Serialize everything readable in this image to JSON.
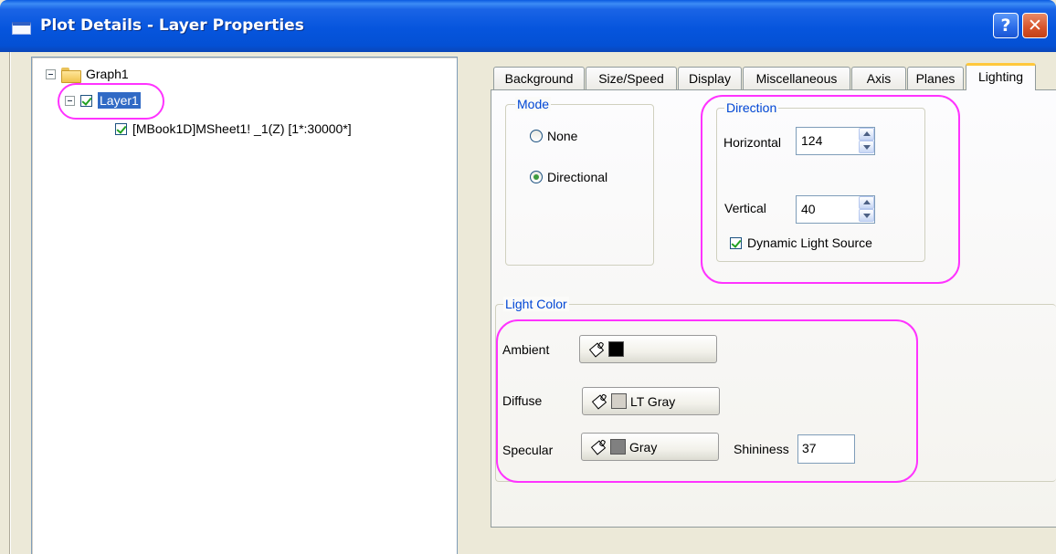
{
  "window": {
    "title": "Plot Details - Layer Properties",
    "help_glyph": "?",
    "close_glyph": "✕"
  },
  "tree": {
    "root": "Graph1",
    "layer": "Layer1",
    "dataset": "[MBook1D]MSheet1! _1(Z) [1*:30000*]"
  },
  "tabs": [
    "Background",
    "Size/Speed",
    "Display",
    "Miscellaneous",
    "Axis",
    "Planes",
    "Lighting"
  ],
  "active_tab": "Lighting",
  "mode": {
    "title": "Mode",
    "options": [
      "None",
      "Directional"
    ],
    "selected": "Directional"
  },
  "direction": {
    "title": "Direction",
    "horizontal_label": "Horizontal",
    "horizontal_value": "124",
    "vertical_label": "Vertical",
    "vertical_value": "40",
    "dynamic_label": "Dynamic Light Source",
    "dynamic_checked": true
  },
  "light_color": {
    "title": "Light Color",
    "ambient_label": "Ambient",
    "ambient_color": "#000000",
    "ambient_text": "",
    "diffuse_label": "Diffuse",
    "diffuse_color": "#d4d0c8",
    "diffuse_text": "LT Gray",
    "specular_label": "Specular",
    "specular_color": "#808080",
    "specular_text": "Gray",
    "shininess_label": "Shininess",
    "shininess_value": "37"
  },
  "colors": {
    "highlight": "#ff33ff",
    "selection": "#316ac5",
    "group_title": "#0046d5"
  }
}
